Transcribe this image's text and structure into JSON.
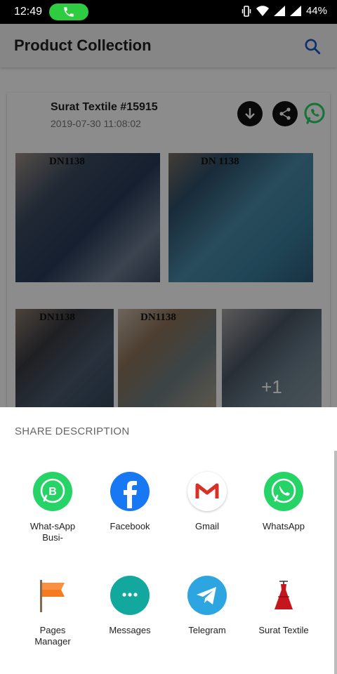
{
  "status_bar": {
    "time": "12:49",
    "battery": "44%"
  },
  "app_bar": {
    "title": "Product Collection"
  },
  "post": {
    "title": "Surat Textile #15915",
    "date": "2019-07-30 11:08:02",
    "image_labels": [
      "DN1138",
      "DN 1138",
      "DN1138",
      "DN1138"
    ],
    "more_count": "+1"
  },
  "share_sheet": {
    "title": "SHARE DESCRIPTION",
    "apps": [
      {
        "label": "What-sApp Busi-",
        "icon": "whatsapp-business-icon"
      },
      {
        "label": "Facebook",
        "icon": "facebook-icon"
      },
      {
        "label": "Gmail",
        "icon": "gmail-icon"
      },
      {
        "label": "WhatsApp",
        "icon": "whatsapp-icon"
      },
      {
        "label": "Pages Manager",
        "icon": "pages-manager-icon"
      },
      {
        "label": "Messages",
        "icon": "messages-icon"
      },
      {
        "label": "Telegram",
        "icon": "telegram-icon"
      },
      {
        "label": "Surat Textile",
        "icon": "surat-textile-icon"
      }
    ]
  },
  "colors": {
    "whatsapp": "#25d366",
    "facebook": "#1877f2",
    "gmail": "#d93025",
    "telegram": "#2ca5e0",
    "messages": "#13a89e",
    "accent": "#1a56c8"
  }
}
